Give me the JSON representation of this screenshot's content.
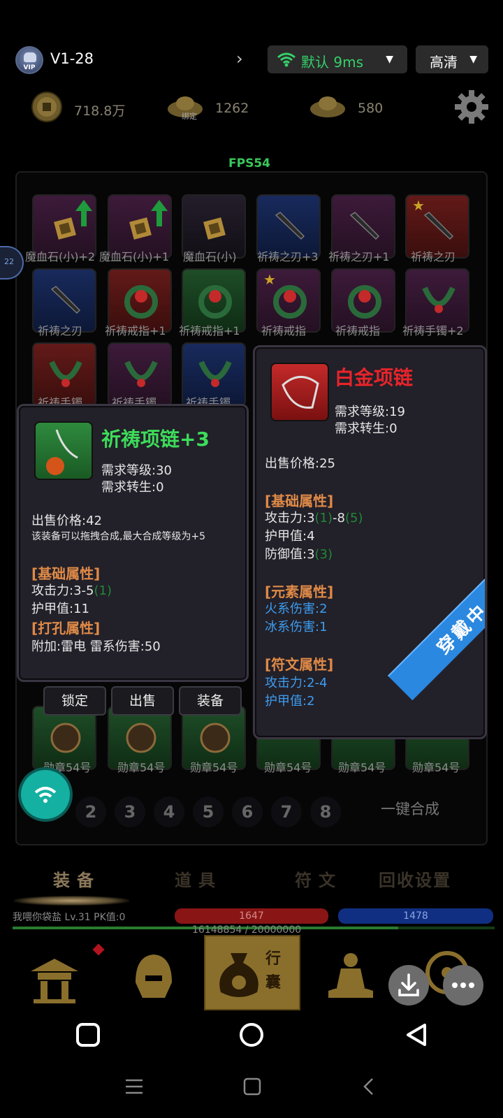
{
  "topbar": {
    "server": "V1-28",
    "vip": "VIP",
    "network": "默认 9ms",
    "quality": "高清"
  },
  "currency": {
    "coins": "718.8万",
    "bound_gold_tag": "绑定",
    "bound_gold": "1262",
    "gold": "580"
  },
  "fps": "FPS54",
  "side_badge": "22",
  "grid": [
    {
      "label": "魔血石(小)+2",
      "color": "purple"
    },
    {
      "label": "魔血石(小)+1",
      "color": "purple"
    },
    {
      "label": "魔血石(小)",
      "color": "purple"
    },
    {
      "label": "祈祷之刃+3",
      "color": "blue"
    },
    {
      "label": "祈祷之刃+1",
      "color": "purple"
    },
    {
      "label": "祈祷之刃",
      "color": "red"
    },
    {
      "label": "祈祷之刃",
      "color": "blue"
    },
    {
      "label": "祈祷戒指+1",
      "color": "red"
    },
    {
      "label": "祈祷戒指+1",
      "color": "green"
    },
    {
      "label": "祈祷戒指",
      "color": "purple"
    },
    {
      "label": "祈祷戒指",
      "color": "purple"
    },
    {
      "label": "祈祷手镯+2",
      "color": "purple"
    },
    {
      "label": "祈祷手镯",
      "color": "red"
    },
    {
      "label": "祈祷手镯",
      "color": "purple"
    },
    {
      "label": "祈祷手镯",
      "color": "blue"
    }
  ],
  "bottom_row": [
    "勋章54号",
    "勋章54号",
    "勋章54号",
    "勋章54号",
    "勋章54号",
    "勋章54号"
  ],
  "tip_left": {
    "title": "祈祷项链+3",
    "req_level": "需求等级:30",
    "req_rebirth": "需求转生:0",
    "price": "出售价格:42",
    "note": "该装备可以拖拽合成,最大合成等级为+5",
    "sec_base": "[基础属性]",
    "atk": "攻击力:3-5",
    "atk_bonus": "(1)",
    "armor": "护甲值:11",
    "sec_socket": "[打孔属性]",
    "socket": "附加:雷电 雷系伤害:50"
  },
  "actions": {
    "lock": "锁定",
    "sell": "出售",
    "equip": "装备"
  },
  "tip_right": {
    "title": "白金项链",
    "req_level": "需求等级:19",
    "req_rebirth": "需求转生:0",
    "price": "出售价格:25",
    "sec_base": "[基础属性]",
    "atk_a": "攻击力:3",
    "atk_b": "(1)",
    "atk_c": "-8",
    "atk_d": "(5)",
    "armor": "护甲值:4",
    "def_a": "防御值:3",
    "def_b": "(3)",
    "sec_elem": "[元素属性]",
    "fire": "火系伤害:2",
    "ice": "冰系伤害:1",
    "sec_rune": "[符文属性]",
    "rune_atk": "攻击力:2-4",
    "rune_armor": "护甲值:2",
    "ribbon": "穿戴中"
  },
  "pages": [
    "2",
    "3",
    "4",
    "5",
    "6",
    "7",
    "8"
  ],
  "merge": "一键合成",
  "tabs": [
    "装备",
    "道具",
    "符文",
    "回收设置"
  ],
  "status": {
    "name": "我喂你袋盐  Lv.31 PK值:0",
    "hp": "1647",
    "mp": "1478",
    "xp": "16148854 / 20000000"
  },
  "bag": {
    "word1": "行",
    "word2": "囊"
  },
  "colors": {
    "accent_green": "#35d06a",
    "tip_bg": "#222029",
    "title_green": "#3ddc5a",
    "title_red": "#e8242a",
    "sec_orange": "#e08a47",
    "elem_blue": "#3d9df0"
  }
}
